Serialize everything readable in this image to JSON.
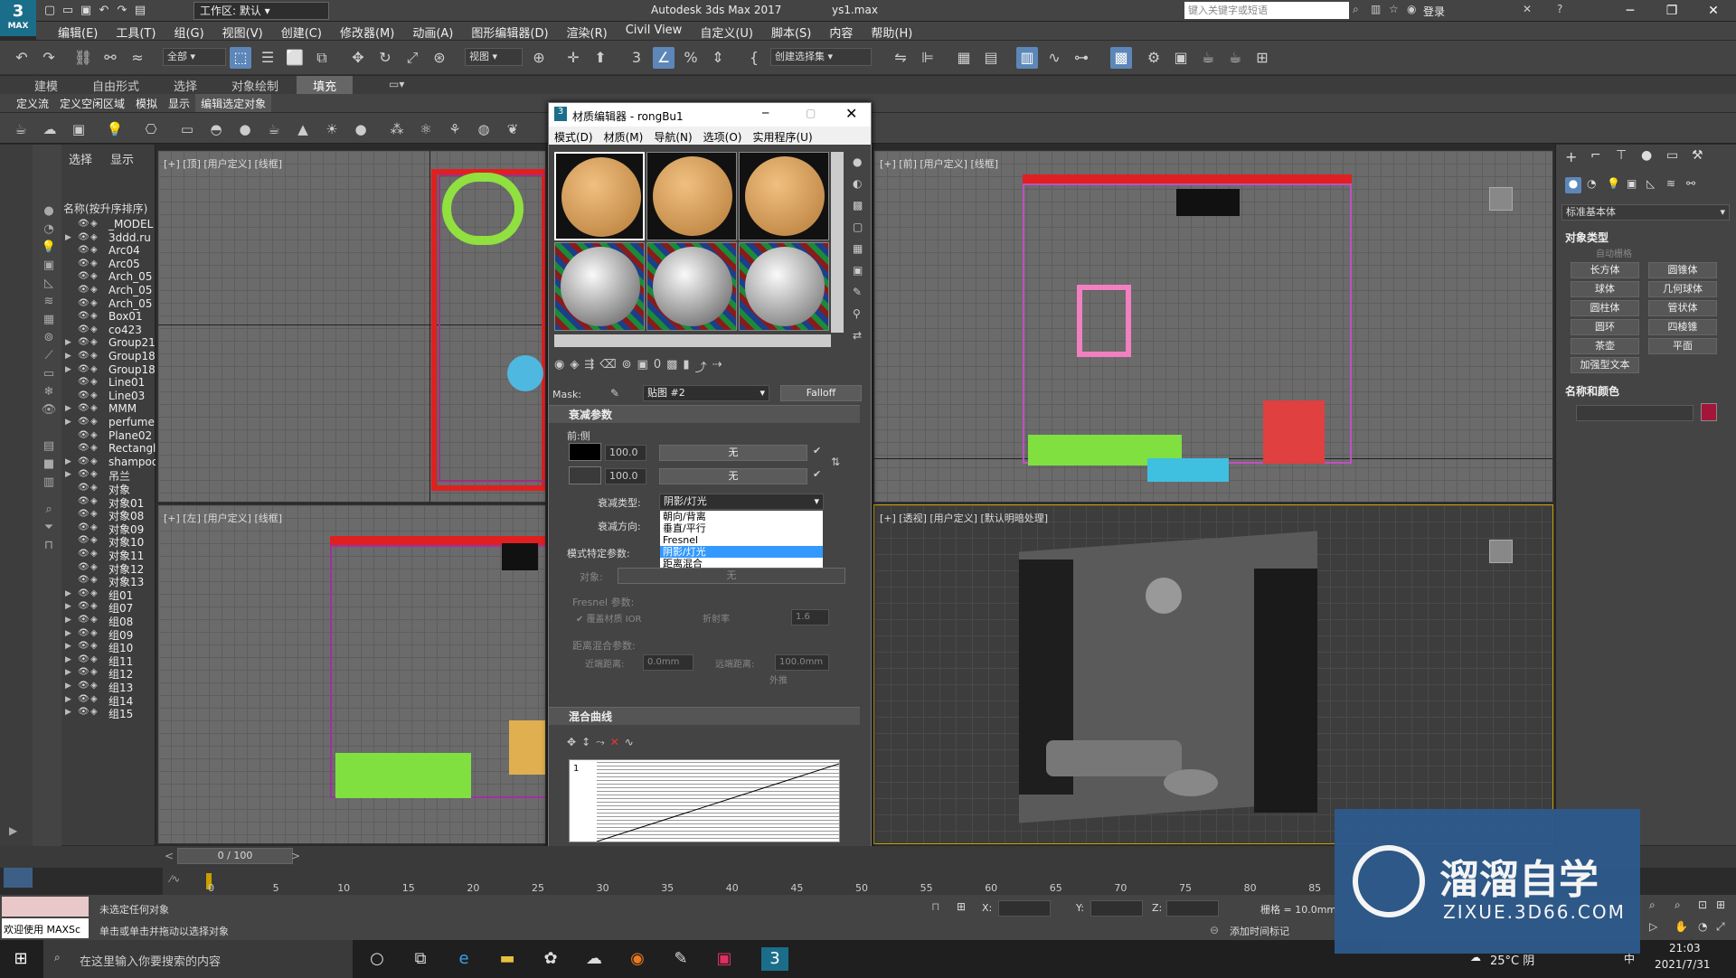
{
  "app": {
    "logo_text": "3",
    "logo_sub": "MAX",
    "title": "Autodesk 3ds Max 2017",
    "file": "ys1.max",
    "workspace": "工作区: 默认",
    "search_placeholder": "键入关键字或短语",
    "login": "登录"
  },
  "menu": [
    "编辑(E)",
    "工具(T)",
    "组(G)",
    "视图(V)",
    "创建(C)",
    "修改器(M)",
    "动画(A)",
    "图形编辑器(D)",
    "渲染(R)",
    "Civil View",
    "自定义(U)",
    "脚本(S)",
    "内容",
    "帮助(H)"
  ],
  "toolbar": {
    "selection_filter": "全部",
    "ref_coord": "视图",
    "named_selection": "创建选择集"
  },
  "ribbon_tabs": [
    "建模",
    "自由形式",
    "选择",
    "对象绘制",
    "填充"
  ],
  "sub_tabs": [
    "定义流",
    "定义空闲区域",
    "模拟",
    "显示",
    "编辑选定对象"
  ],
  "explorer": {
    "tabs": [
      "选择",
      "显示"
    ],
    "column_header": "名称(按升序排序)",
    "items": [
      {
        "name": "_MODEL",
        "expandable": false
      },
      {
        "name": "3ddd.ru",
        "expandable": true
      },
      {
        "name": "Arc04",
        "expandable": false
      },
      {
        "name": "Arc05",
        "expandable": false
      },
      {
        "name": "Arch_05",
        "expandable": false
      },
      {
        "name": "Arch_05",
        "expandable": false
      },
      {
        "name": "Arch_05",
        "expandable": false
      },
      {
        "name": "Box01",
        "expandable": false
      },
      {
        "name": "co423",
        "expandable": false
      },
      {
        "name": "Group21",
        "expandable": true
      },
      {
        "name": "Group18",
        "expandable": true
      },
      {
        "name": "Group18",
        "expandable": true
      },
      {
        "name": "Line01",
        "expandable": false
      },
      {
        "name": "Line03",
        "expandable": false
      },
      {
        "name": "MMM",
        "expandable": true
      },
      {
        "name": "perfume",
        "expandable": true
      },
      {
        "name": "Plane02",
        "expandable": false
      },
      {
        "name": "Rectangl",
        "expandable": false
      },
      {
        "name": "shampoo",
        "expandable": true
      },
      {
        "name": "吊兰",
        "expandable": true
      },
      {
        "name": "对象",
        "expandable": false
      },
      {
        "name": "对象01",
        "expandable": false
      },
      {
        "name": "对象08",
        "expandable": false
      },
      {
        "name": "对象09",
        "expandable": false
      },
      {
        "name": "对象10",
        "expandable": false
      },
      {
        "name": "对象11",
        "expandable": false
      },
      {
        "name": "对象12",
        "expandable": false
      },
      {
        "name": "对象13",
        "expandable": false
      },
      {
        "name": "组01",
        "expandable": true
      },
      {
        "name": "组07",
        "expandable": true
      },
      {
        "name": "组08",
        "expandable": true
      },
      {
        "name": "组09",
        "expandable": true
      },
      {
        "name": "组10",
        "expandable": true
      },
      {
        "name": "组11",
        "expandable": true
      },
      {
        "name": "组12",
        "expandable": true
      },
      {
        "name": "组13",
        "expandable": true
      },
      {
        "name": "组14",
        "expandable": true
      },
      {
        "name": "组15",
        "expandable": true
      }
    ]
  },
  "viewports": {
    "top": "[+] [顶] [用户定义] [线框]",
    "front": "[+] [前] [用户定义] [线框]",
    "left": "[+] [左] [用户定义] [线框]",
    "persp": "[+] [透视] [用户定义] [默认明暗处理]"
  },
  "material_editor": {
    "title": "材质编辑器 - rongBu1",
    "menu": [
      "模式(D)",
      "材质(M)",
      "导航(N)",
      "选项(O)",
      "实用程序(U)"
    ],
    "mask_label": "Mask:",
    "mask_value": "贴图 #2",
    "map_type": "Falloff",
    "rollout_falloff": "衰减参数",
    "front_side": "前:侧",
    "field1": "100.0",
    "field2": "100.0",
    "none": "无",
    "falloff_type_label": "衰减类型:",
    "falloff_type_value": "阴影/灯光",
    "falloff_dir_label": "衰减方向:",
    "mode_specific": "模式特定参数:",
    "object_label": "对象:",
    "object_value": "无",
    "fresnel_params": "Fresnel 参数:",
    "override_ior": "覆盖材质 IOR",
    "ior_label": "折射率",
    "ior_value": "1.6",
    "distance_blend": "距离混合参数:",
    "near_label": "近端距离:",
    "near_value": "0.0mm",
    "far_label": "远端距离:",
    "far_value": "100.0mm",
    "extrapolate": "外推",
    "rollout_curve": "混合曲线",
    "curve_num": "1",
    "dropdown_options": [
      "朝向/背离",
      "垂直/平行",
      "Fresnel",
      "阴影/灯光",
      "距离混合"
    ],
    "dropdown_selected": 3
  },
  "command_panel": {
    "dropdown": "标准基本体",
    "object_type": "对象类型",
    "autogrid": "自动栅格",
    "buttons": [
      "长方体",
      "圆锥体",
      "球体",
      "几何球体",
      "圆柱体",
      "管状体",
      "圆环",
      "四棱锥",
      "茶壶",
      "平面",
      "加强型文本"
    ],
    "name_color": "名称和颜色",
    "color": "#a3163a"
  },
  "timeline": {
    "frame": "0 / 100",
    "ticks": [
      "0",
      "5",
      "10",
      "15",
      "20",
      "25",
      "30",
      "35",
      "40",
      "45",
      "50",
      "55",
      "60",
      "65",
      "70",
      "75",
      "80",
      "85"
    ]
  },
  "status": {
    "maxscript": "欢迎使用 MAXSc",
    "line1": "未选定任何对象",
    "line2": "单击或单击并拖动以选择对象",
    "x_label": "X:",
    "y_label": "Y:",
    "z_label": "Z:",
    "grid": "栅格 = 10.0mm",
    "add_time_tag": "添加时间标记"
  },
  "taskbar": {
    "search": "在这里输入你要搜索的内容",
    "weather": "25°C 阴",
    "ime": "中",
    "time": "21:03",
    "date": "2021/7/31"
  },
  "watermark": {
    "brand": "溜溜自学",
    "url": "ZIXUE.3D66.COM"
  }
}
